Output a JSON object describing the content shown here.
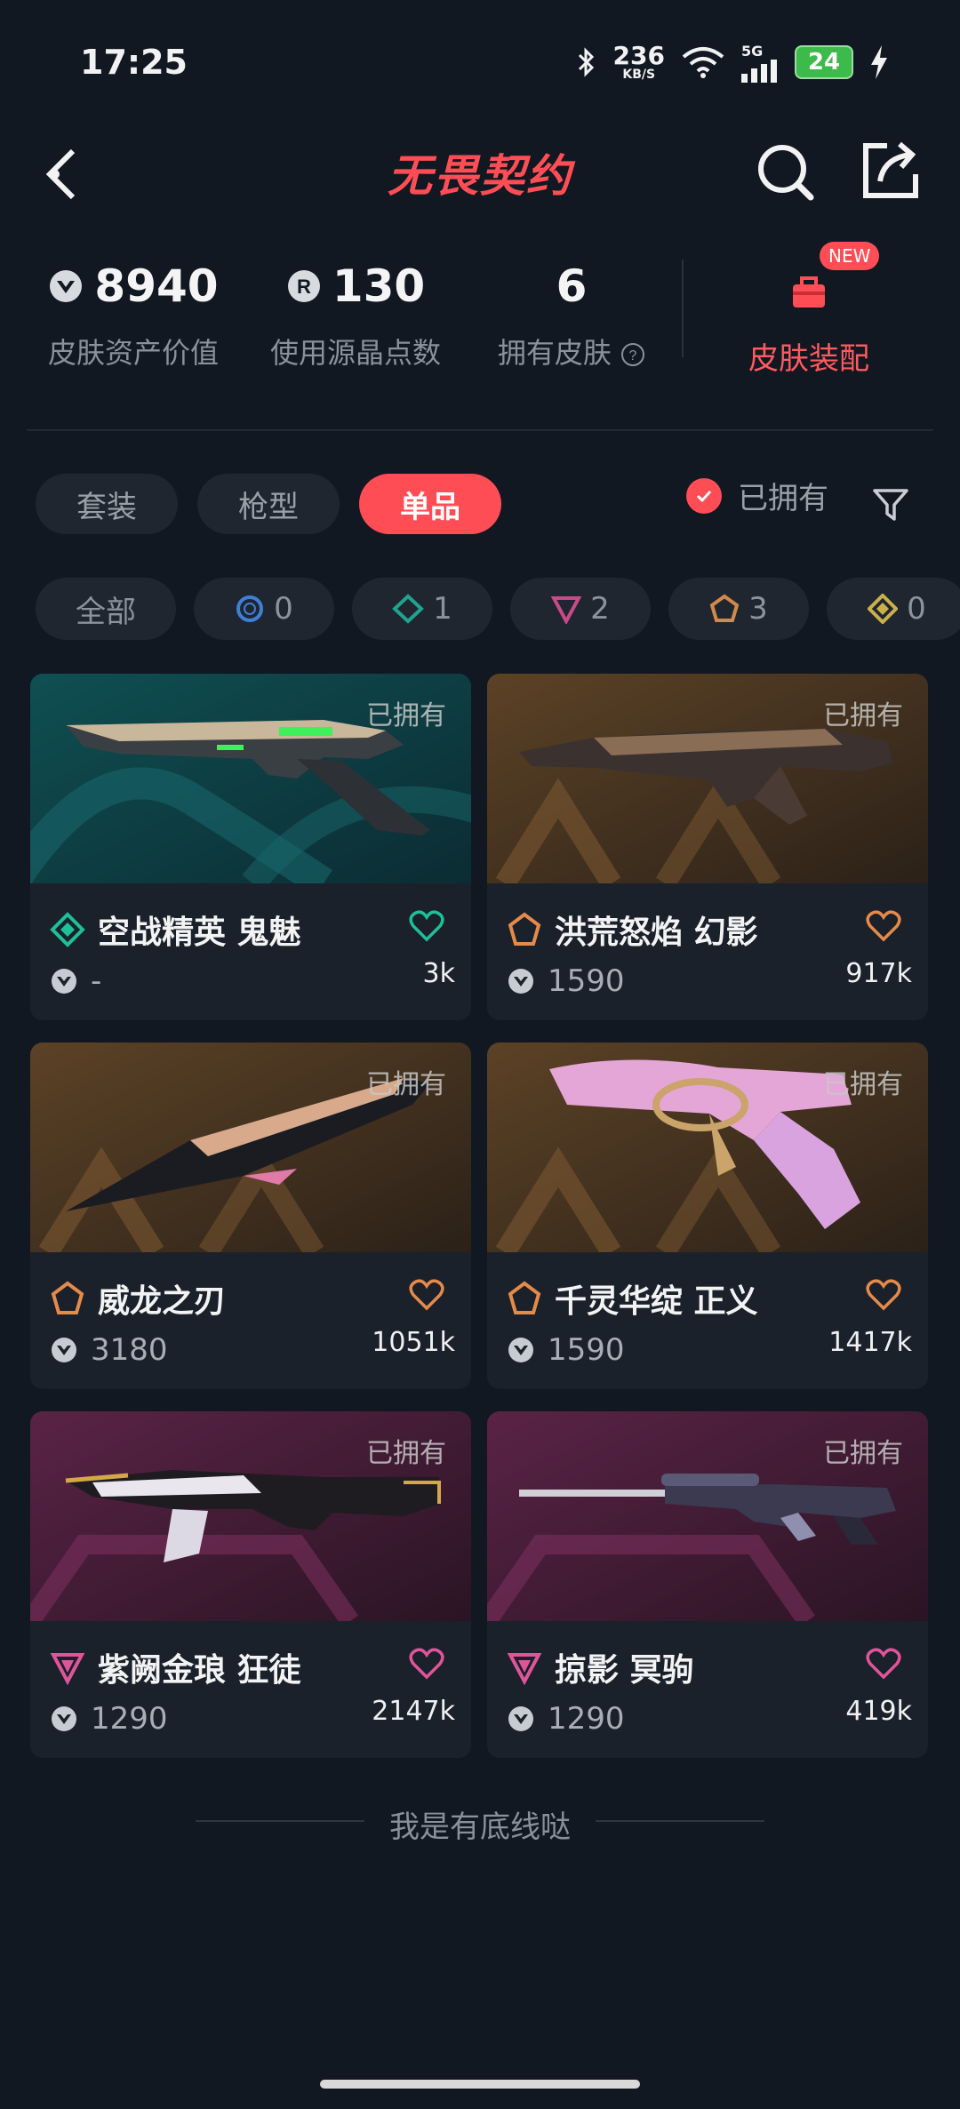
{
  "status_bar": {
    "time": "17:25",
    "net_speed": "236",
    "net_unit": "KB/S",
    "network": "5G",
    "battery": "24"
  },
  "header": {
    "title": "无畏契约",
    "back_icon": "chevron-left-icon",
    "search_icon": "search-icon",
    "share_icon": "share-icon"
  },
  "stats": [
    {
      "value": "8940",
      "label": "皮肤资产价值",
      "icon": "vp-icon"
    },
    {
      "value": "130",
      "label": "使用源晶点数",
      "icon": "radianite-icon"
    },
    {
      "value": "6",
      "label": "拥有皮肤",
      "icon": "help-icon"
    }
  ],
  "equip": {
    "label": "皮肤装配",
    "badge": "NEW",
    "icon": "bag-icon"
  },
  "category_tabs": [
    {
      "label": "套装",
      "active": false
    },
    {
      "label": "枪型",
      "active": false
    },
    {
      "label": "单品",
      "active": true
    }
  ],
  "owned_filter": {
    "label": "已拥有",
    "checked": true
  },
  "tiers": [
    {
      "label": "全部",
      "icon": ""
    },
    {
      "count": "0",
      "icon": "select-tier-icon",
      "color": "#3f7fd6"
    },
    {
      "count": "1",
      "icon": "deluxe-tier-icon",
      "color": "#1fa38f"
    },
    {
      "count": "2",
      "icon": "premium-tier-icon",
      "color": "#c84a8a"
    },
    {
      "count": "3",
      "icon": "exclusive-tier-icon",
      "color": "#d18a4a"
    },
    {
      "count": "0",
      "icon": "ultra-tier-icon",
      "color": "#c9b04a"
    }
  ],
  "cards": [
    {
      "owned": "已拥有",
      "name": "空战精英 鬼魅",
      "price": "-",
      "likes": "3k",
      "tier_color": "#1fbf9a",
      "heart_color": "#1fbf9a",
      "bg": "teal"
    },
    {
      "owned": "已拥有",
      "name": "洪荒怒焰 幻影",
      "price": "1590",
      "likes": "917k",
      "tier_color": "#e68a4a",
      "heart_color": "#e68a4a",
      "bg": "orange"
    },
    {
      "owned": "已拥有",
      "name": "威龙之刃",
      "price": "3180",
      "likes": "1051k",
      "tier_color": "#e68a4a",
      "heart_color": "#e68a4a",
      "bg": "orange"
    },
    {
      "owned": "已拥有",
      "name": "千灵华绽 正义",
      "price": "1590",
      "likes": "1417k",
      "tier_color": "#e68a4a",
      "heart_color": "#e68a4a",
      "bg": "orange"
    },
    {
      "owned": "已拥有",
      "name": "紫阙金琅 狂徒",
      "price": "1290",
      "likes": "2147k",
      "tier_color": "#e0559a",
      "heart_color": "#e0559a",
      "bg": "purple"
    },
    {
      "owned": "已拥有",
      "name": "掠影 冥驹",
      "price": "1290",
      "likes": "419k",
      "tier_color": "#e0559a",
      "heart_color": "#e0559a",
      "bg": "purple"
    }
  ],
  "footer": {
    "text": "我是有底线哒"
  }
}
